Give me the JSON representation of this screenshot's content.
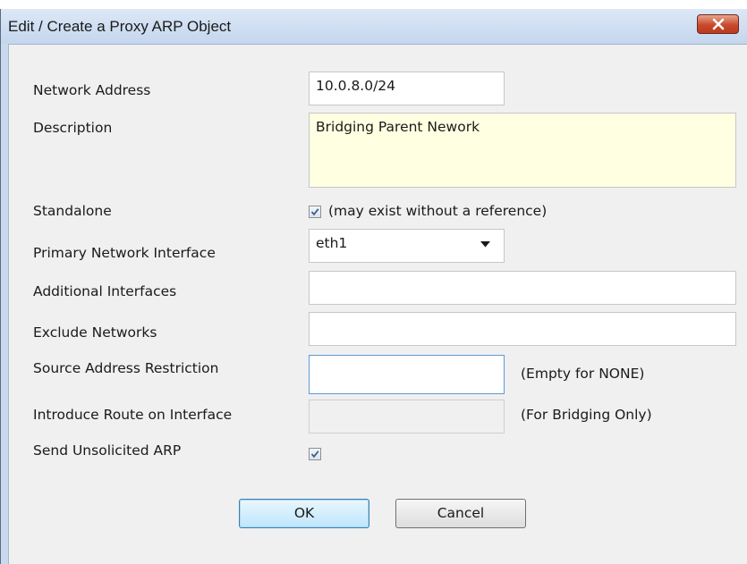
{
  "window": {
    "title": "Edit / Create a Proxy ARP Object"
  },
  "fields": {
    "network_address": {
      "label": "Network Address",
      "value": "10.0.8.0/24"
    },
    "description": {
      "label": "Description",
      "value": "Bridging Parent Nework"
    },
    "standalone": {
      "label": "Standalone",
      "checked": true,
      "note": "(may exist without a reference)"
    },
    "primary_interface": {
      "label": "Primary Network Interface",
      "value": "eth1"
    },
    "additional_interfaces": {
      "label": "Additional Interfaces",
      "value": ""
    },
    "exclude_networks": {
      "label": "Exclude Networks",
      "value": ""
    },
    "source_restriction": {
      "label": "Source Address Restriction",
      "value": "",
      "note": "(Empty for NONE)"
    },
    "introduce_route": {
      "label": "Introduce Route on Interface",
      "value": "",
      "note": "(For Bridging Only)"
    },
    "send_unsolicited_arp": {
      "label": "Send Unsolicited ARP",
      "checked": true
    }
  },
  "buttons": {
    "ok": "OK",
    "cancel": "Cancel"
  },
  "icons": {
    "close": "close-icon",
    "check": "checkmark-icon",
    "dropdown": "chevron-down-icon"
  },
  "colors": {
    "title_bar": "#c9d9ee",
    "client_bg": "#f0f0f0",
    "description_bg": "#ffffe1",
    "close_button": "#c84a2c",
    "focus_border": "#5d9ad8"
  }
}
